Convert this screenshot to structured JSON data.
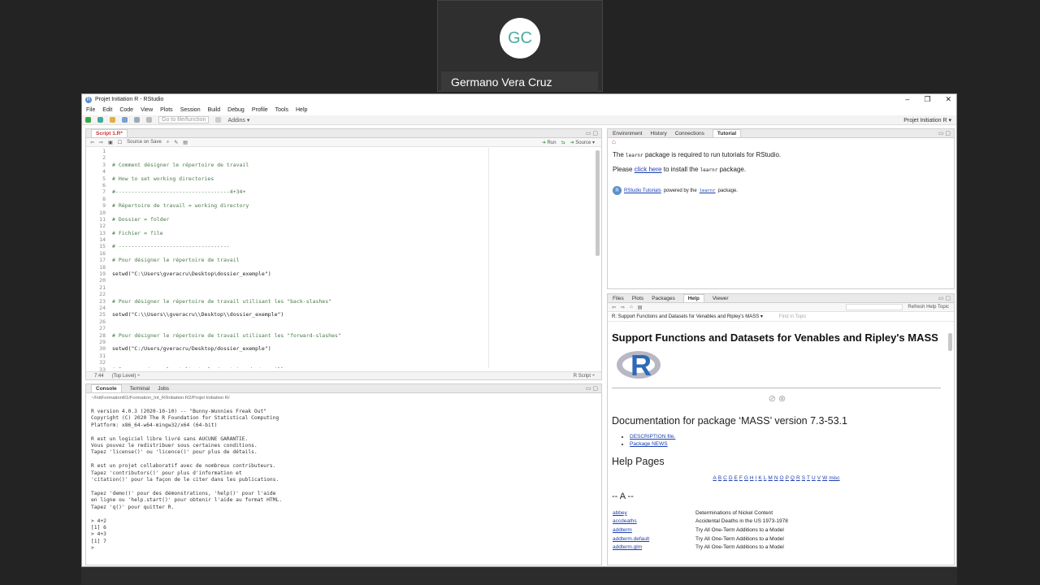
{
  "meeting": {
    "initials": "GC",
    "participant_name": "Germano Vera Cruz"
  },
  "window": {
    "title": "Projet Initiation R - RStudio",
    "controls": [
      "–",
      "❐",
      "✕"
    ]
  },
  "menu": [
    "File",
    "Edit",
    "Code",
    "View",
    "Plots",
    "Session",
    "Build",
    "Debug",
    "Profile",
    "Tools",
    "Help"
  ],
  "toolbar": {
    "goto_placeholder": "Go to file/function",
    "addins": "Addins ▾",
    "project": "Projet Initiation R ▾"
  },
  "editor": {
    "tab": "Script 1.R*",
    "source_on_save": "Source on Save",
    "run": "Run",
    "source": "Source ▾",
    "cursor": "7:44",
    "scope": "(Top Level) ÷",
    "filetype": "R Script ÷",
    "lines": [
      "",
      "",
      "# Comment désigner le répertoire de travail",
      "",
      "# How to set working directories",
      "",
      "#------------------------------------4+34+",
      "",
      "# Répertoire de travail = working directory",
      "",
      "# Dossier = folder",
      "",
      "# Fichier = file",
      "",
      "# -----------------------------------",
      "",
      "# Pour désigner le répertoire de travail",
      "",
      "setwd(\"C:\\Users\\gveracru\\Desktop\\dossier_exemple\")",
      "",
      "",
      "",
      "# Pour désigner le répertoire de travail utilisant les \"back-slashes\"",
      "",
      "setwd(\"C:\\\\Users\\\\gveracru\\\\Desktop\\\\dossier_exemple\")",
      "",
      "",
      "# Pour désigner le répertoire de travail utilisant les \"forward-slashes\"",
      "",
      "setwd(\"C:/Users/gveracru/Desktop/dossier_exemple\")",
      "",
      "",
      "# Pour savoir quel est l'actuel répertoire de travaille"
    ],
    "line_numbers": [
      "1",
      "2",
      "3",
      "4",
      "5",
      "6",
      "7",
      "8",
      "9",
      "10",
      "11",
      "12",
      "13",
      "14",
      "15",
      "16",
      "17",
      "18",
      "19",
      "20",
      "21",
      "22",
      "23",
      "24",
      "25",
      "26",
      "27",
      "28",
      "29",
      "30",
      "31",
      "32",
      "33"
    ]
  },
  "console": {
    "tabs": [
      "Console",
      "Terminal",
      "Jobs"
    ],
    "path": "~/InitFormationR1/Formation_Int_R/Initiation R2/Projet Initiation R/",
    "text": "R version 4.0.3 (2020-10-10) -- \"Bunny-Wunnies Freak Out\"\nCopyright (C) 2020 The R Foundation for Statistical Computing\nPlatform: x86_64-w64-mingw32/x64 (64-bit)\n\nR est un logiciel libre livré sans AUCUNE GARANTIE.\nVous pouvez le redistribuer sous certaines conditions.\nTapez 'license()' ou 'licence()' pour plus de détails.\n\nR est un projet collaboratif avec de nombreux contributeurs.\nTapez 'contributors()' pour plus d'information et\n'citation()' pour la façon de le citer dans les publications.\n\nTapez 'demo()' pour des démonstrations, 'help()' pour l'aide\nen ligne ou 'help.start()' pour obtenir l'aide au format HTML.\nTapez 'q()' pour quitter R.\n\n> 4+2\n[1] 6\n> 4+3\n[1] 7\n> "
  },
  "tutorial": {
    "tabs": [
      "Environment",
      "History",
      "Connections",
      "Tutorial"
    ],
    "line1_a": "The",
    "line1_code": "learnr",
    "line1_b": "package is required to run tutorials for RStudio.",
    "line2_a": "Please",
    "line2_link": "click here",
    "line2_b": "to install the",
    "line2_code": "learnr",
    "line2_c": "package.",
    "footer_link": "RStudio Tutorials",
    "footer_a": "powered by the",
    "footer_code": "learnr",
    "footer_b": "package."
  },
  "help": {
    "tabs": [
      "Files",
      "Plots",
      "Packages",
      "Help",
      "Viewer"
    ],
    "breadcrumb": "R: Support Functions and Datasets for Venables and Ripley's MASS ▾",
    "find_placeholder": "Find in Topic",
    "refresh": "Refresh Help Topic",
    "title": "Support Functions and Datasets for Venables and Ripley's MASS",
    "doc_title": "Documentation for package ‘MASS’ version 7.3-53.1",
    "desc_link": "DESCRIPTION file.",
    "news_link": "Package NEWS",
    "help_pages": "Help Pages",
    "letters": [
      "A",
      "B",
      "C",
      "D",
      "E",
      "F",
      "G",
      "H",
      "I",
      "K",
      "L",
      "M",
      "N",
      "O",
      "P",
      "Q",
      "R",
      "S",
      "T",
      "U",
      "V",
      "W",
      "misc"
    ],
    "section": "-- A --",
    "rows": [
      {
        "name": "abbey",
        "desc": "Determinations of Nickel Content"
      },
      {
        "name": "accdeaths",
        "desc": "Accidental Deaths in the US 1973-1978"
      },
      {
        "name": "addterm",
        "desc": "Try All One-Term Additions to a Model"
      },
      {
        "name": "addterm.default",
        "desc": "Try All One-Term Additions to a Model"
      },
      {
        "name": "addterm.glm",
        "desc": "Try All One-Term Additions to a Model"
      }
    ]
  }
}
